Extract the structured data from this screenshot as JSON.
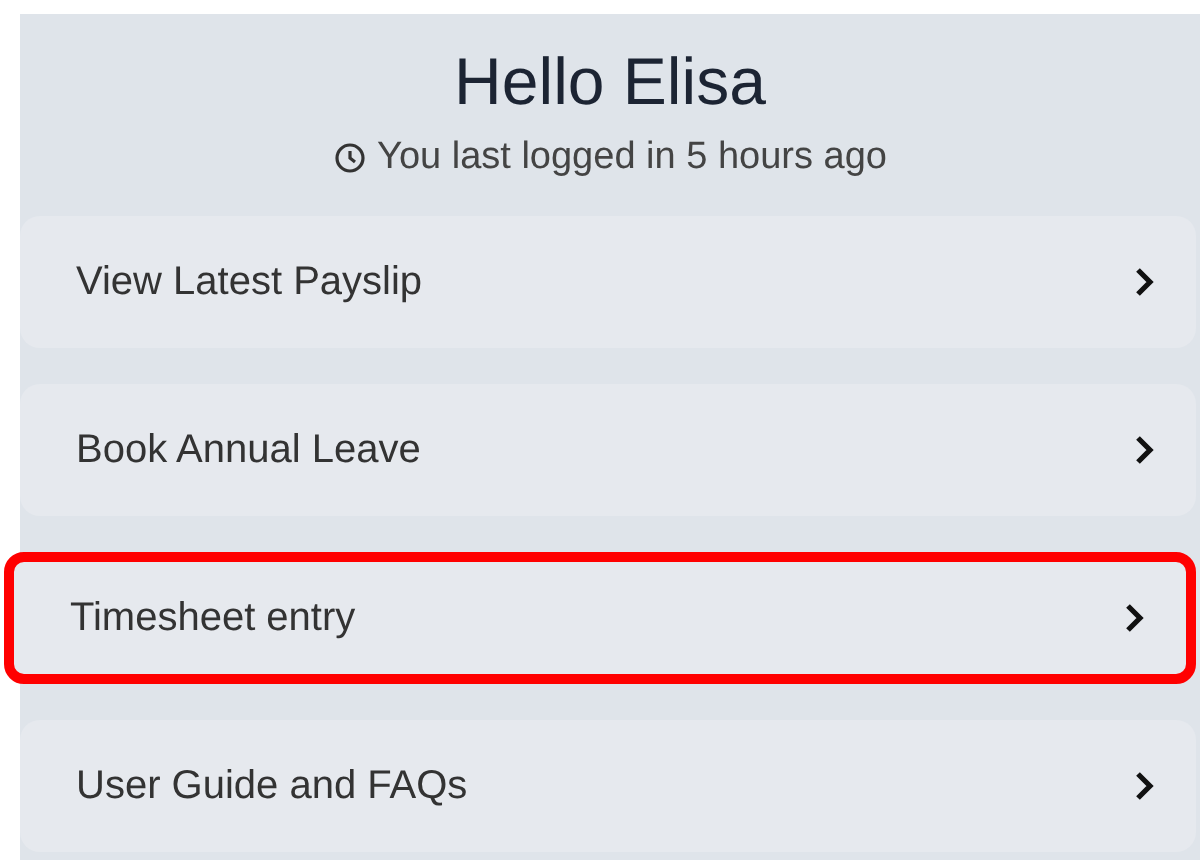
{
  "greeting": "Hello Elisa",
  "last_login": "You last logged in 5 hours ago",
  "menu_items": [
    {
      "label": "View Latest Payslip",
      "highlighted": false
    },
    {
      "label": "Book Annual Leave",
      "highlighted": false
    },
    {
      "label": "Timesheet entry",
      "highlighted": true
    },
    {
      "label": "User Guide and FAQs",
      "highlighted": false
    }
  ]
}
